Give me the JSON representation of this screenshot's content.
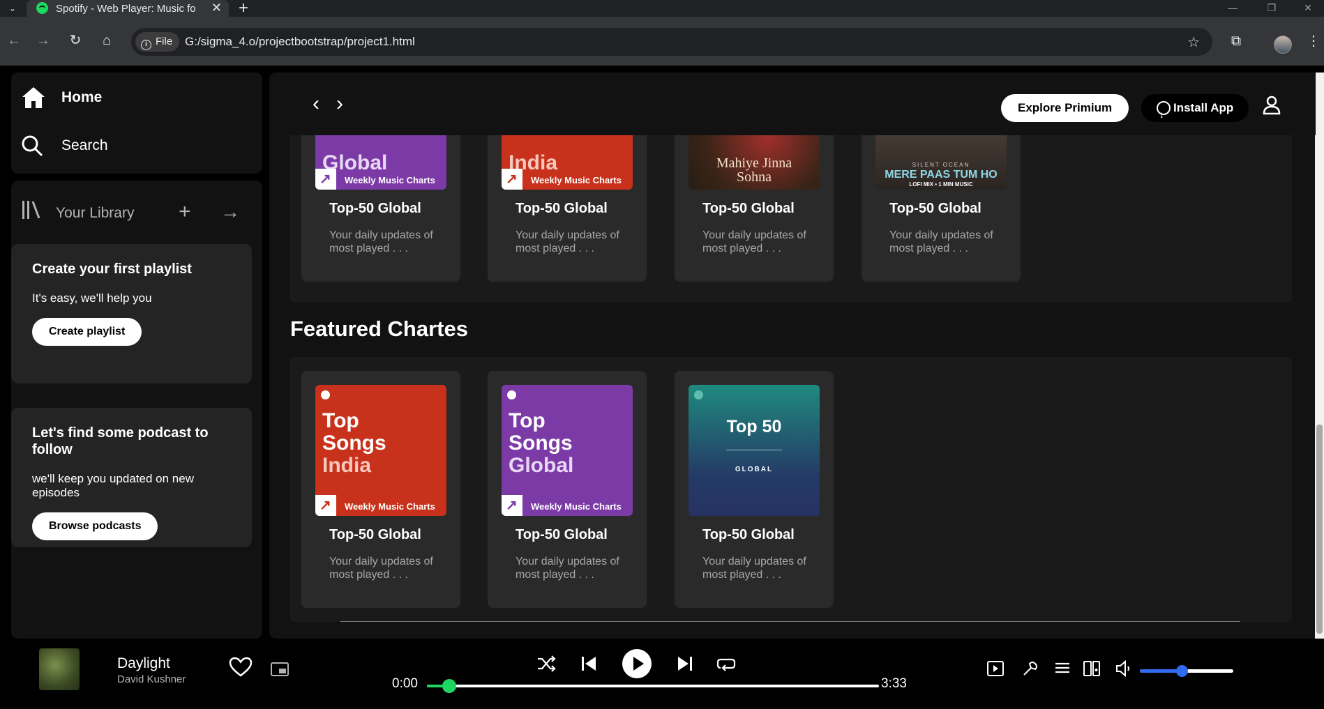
{
  "browser": {
    "tab_title": "Spotify - Web Player: Music for",
    "url_chip": "File",
    "url": "G:/sigma_4.o/projectbootstrap/project1.html"
  },
  "sidebar": {
    "home": "Home",
    "search": "Search",
    "library": "Your Library",
    "playlist_promo": {
      "title": "Create your first playlist",
      "text": "It's easy, we'll help you",
      "button": "Create playlist"
    },
    "podcast_promo": {
      "title": "Let's find some podcast to follow",
      "text": "we'll keep you updated on new episodes",
      "button": "Browse podcasts"
    }
  },
  "header": {
    "explore_button": "Explore Primium",
    "install_button": "Install App"
  },
  "top_cards": [
    {
      "cover_text": "Global",
      "band": "Weekly Music Charts",
      "title": "Top-50 Global",
      "desc": "Your daily updates of most played . . ."
    },
    {
      "cover_text": "India",
      "band": "Weekly Music Charts",
      "title": "Top-50 Global",
      "desc": "Your daily updates of most played . . ."
    },
    {
      "cover_text": "Mahiye Jinna Sohna",
      "title": "Top-50 Global",
      "desc": "Your daily updates of most played . . ."
    },
    {
      "cover_text": "MERE PAAS TUM HO",
      "cover_sub": "SILENT OCEAN",
      "cover_sub2": "LOFI MIX • 1 MIN MUSIC",
      "title": "Top-50 Global",
      "desc": "Your daily updates of most played . . ."
    }
  ],
  "featured": {
    "title": "Featured Chartes",
    "cards": [
      {
        "cover_line1": "Top",
        "cover_line2": "Songs",
        "cover_line3": "India",
        "band": "Weekly Music Charts",
        "title": "Top-50 Global",
        "desc": "Your daily updates of most played . . ."
      },
      {
        "cover_line1": "Top",
        "cover_line2": "Songs",
        "cover_line3": "Global",
        "band": "Weekly Music Charts",
        "title": "Top-50 Global",
        "desc": "Your daily updates of most played . . ."
      },
      {
        "cover_line1": "Top 50",
        "cover_line2": "GLOBAL",
        "title": "Top-50 Global",
        "desc": "Your daily updates of most played . . ."
      }
    ]
  },
  "player": {
    "track": "Daylight",
    "artist": "David Kushner",
    "elapsed": "0:00",
    "duration": "3:33",
    "progress_fraction": 0.05,
    "volume_fraction": 0.45
  },
  "colors": {
    "accent": "#1ed760",
    "purple_cover": "#7c3aa6",
    "red_cover": "#c8321c",
    "volume": "#2f6cf0"
  }
}
